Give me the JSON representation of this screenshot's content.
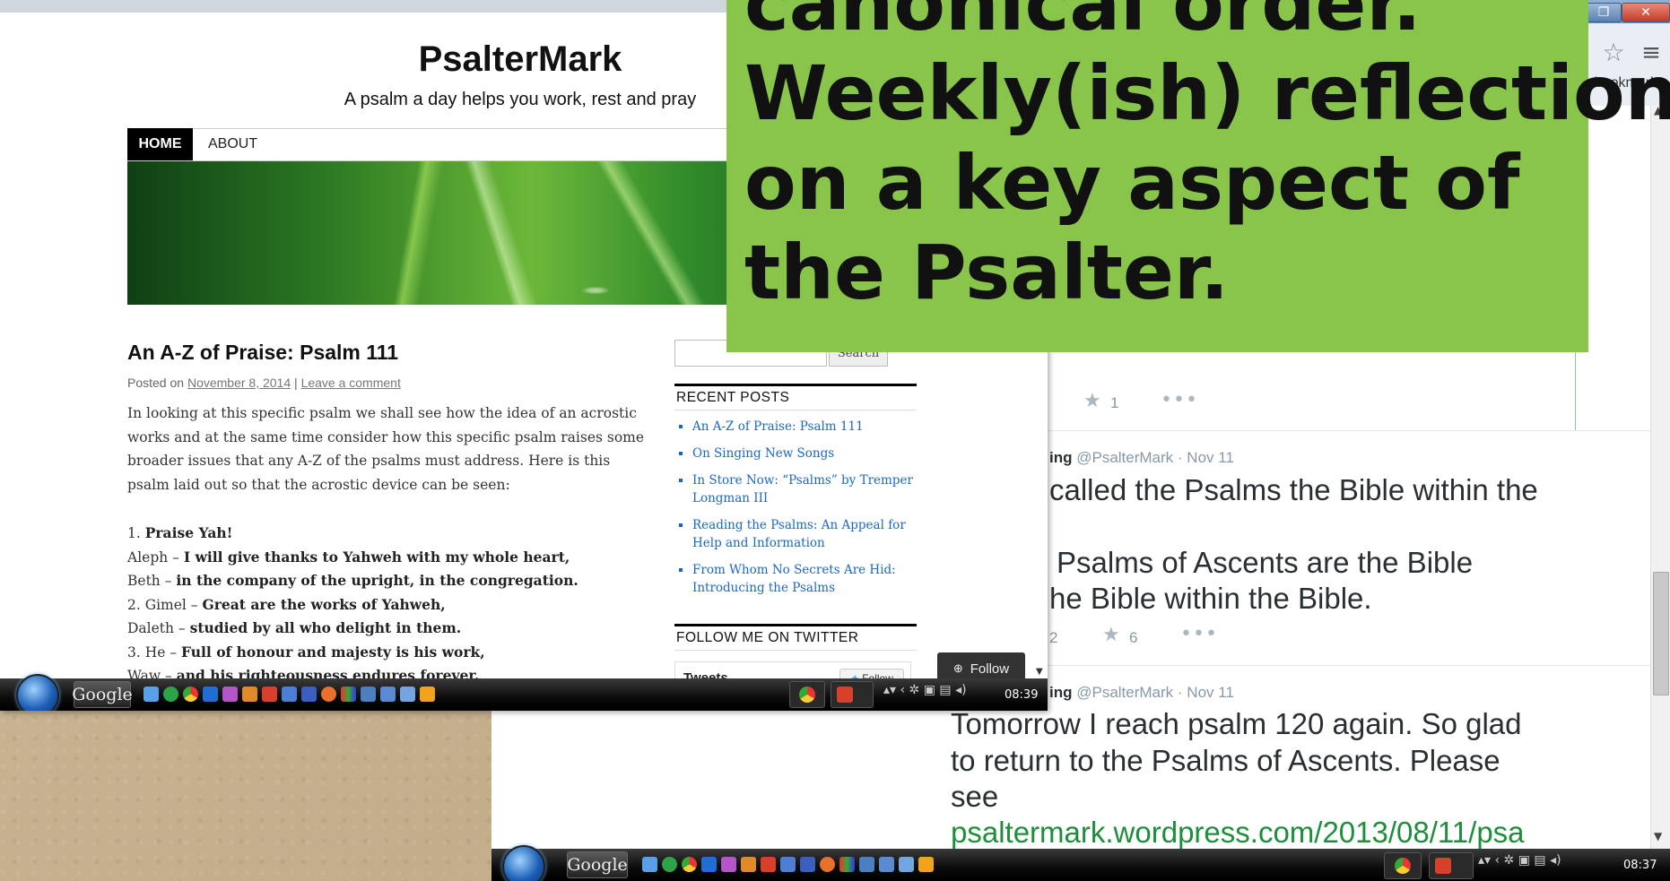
{
  "overlay": {
    "lines": [
      "canonical order.",
      "Weekly(ish) reflection",
      "on a key aspect of",
      "the Psalter."
    ]
  },
  "back_window": {
    "bookmarks_label": "r bookmarks",
    "restore_label": "❐",
    "close_label": "✕",
    "tweets": [
      {
        "favorites": "1"
      },
      {
        "author_fragment": "ing",
        "handle": "@PsalterMark",
        "date": "Nov 11",
        "line1": "called the Psalms the Bible within the",
        "line2": "Psalms of Ascents are the Bible",
        "line3": "he Bible within the Bible.",
        "retweets": "2",
        "favorites": "6"
      },
      {
        "author_fragment": "ing",
        "handle": "@PsalterMark",
        "date": "Nov 11",
        "line1": "Tomorrow I reach psalm 120 again. So glad",
        "line2": "to return to the Psalms of Ascents. Please",
        "line3": "see",
        "link": "psaltermark.wordpress.com/2013/08/11/psa"
      }
    ],
    "taskbar": {
      "google_label": "Google",
      "clock": "08:37"
    }
  },
  "blog": {
    "title": "PsalterMark",
    "tagline": "A psalm a day helps you work, rest and pray",
    "nav": [
      "HOME",
      "ABOUT"
    ],
    "post": {
      "title": "An A-Z of Praise: Psalm 111",
      "posted_on": "Posted on",
      "date": "November 8, 2014",
      "separator": "|",
      "comment_link": "Leave a comment",
      "intro": "In looking at this specific psalm we shall see how the idea of an acrostic works and at the same time consider how this specific psalm raises some broader issues that any A-Z of the psalms must address. Here is this psalm laid out so that the acrostic device can be seen:",
      "verses": [
        {
          "prefix": "1. ",
          "text": "Praise Yah!"
        },
        {
          "prefix": "Aleph – ",
          "text": "I will give thanks to Yahweh with my whole heart,"
        },
        {
          "prefix": "Beth – ",
          "text": "in the company of the upright, in the congregation."
        },
        {
          "prefix": "2. Gimel – ",
          "text": "Great are the works of Yahweh,"
        },
        {
          "prefix": "Daleth – ",
          "text": "studied by all who delight in them."
        },
        {
          "prefix": "3. He – ",
          "text": "Full of honour and majesty is his work,"
        },
        {
          "prefix": "Waw – ",
          "text": "and his righteousness endures forever."
        }
      ]
    },
    "sidebar": {
      "search_button": "Search",
      "recent_heading": "RECENT POSTS",
      "recent_posts": [
        "An A-Z of Praise: Psalm 111",
        "On Singing New Songs",
        "In Store Now: “Psalms” by Tremper Longman III",
        "Reading the Psalms: An Appeal for Help and Information",
        "From Whom No Secrets Are Hid: Introducing the Psalms"
      ],
      "twitter_heading": "FOLLOW ME ON TWITTER",
      "tweets_label": "Tweets",
      "follow_small": "Follow",
      "follow_popup": "Follow"
    },
    "taskbar": {
      "google_label": "Google",
      "clock": "08:39"
    }
  }
}
